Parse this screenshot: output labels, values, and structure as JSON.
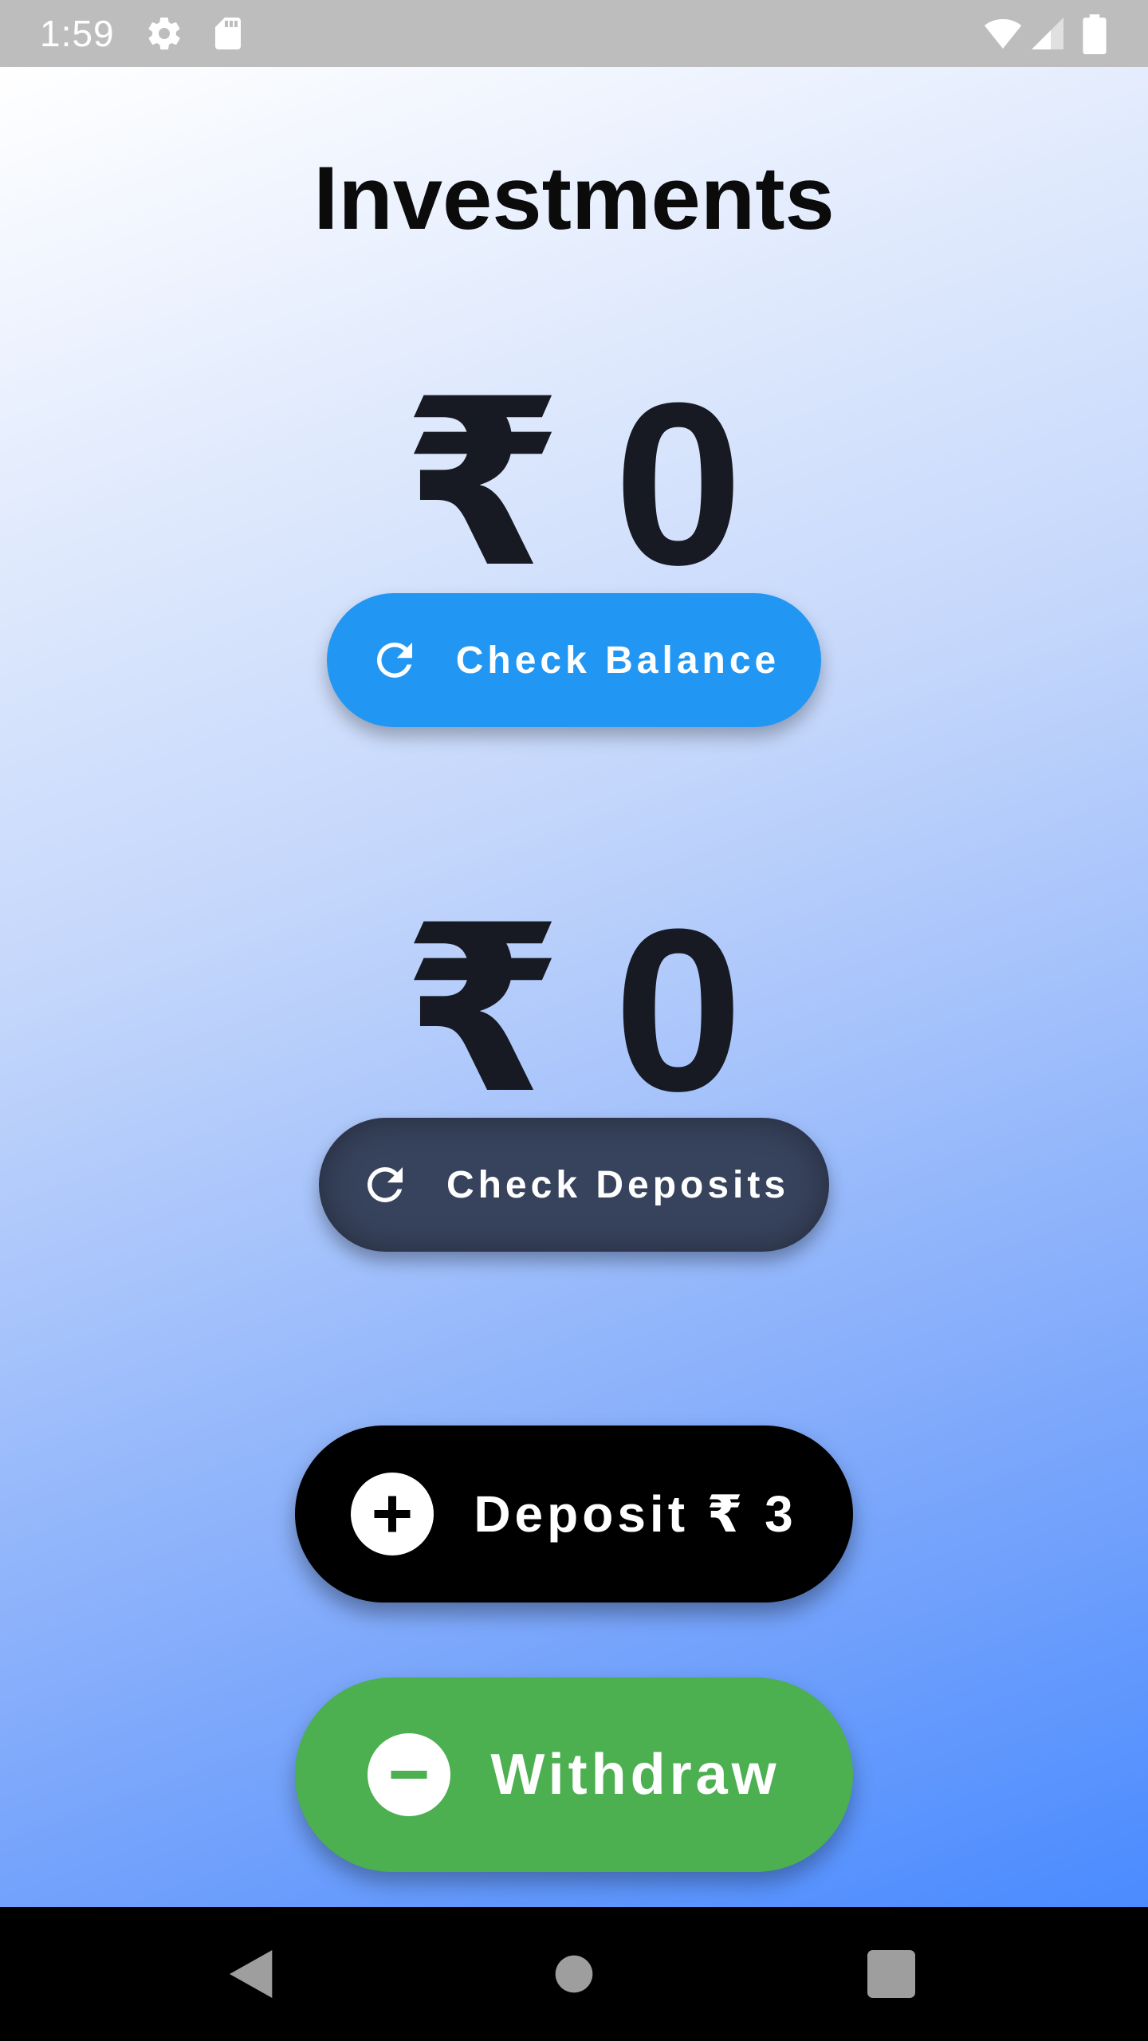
{
  "status_bar": {
    "time": "1:59",
    "icons": [
      "gear-icon",
      "sd-card-icon",
      "wifi-icon",
      "cellular-signal-icon",
      "battery-icon"
    ]
  },
  "page": {
    "title": "Investments"
  },
  "balance": {
    "currency_symbol": "₹",
    "amount": "0",
    "button_label": "Check Balance",
    "button_color": "#2196f3"
  },
  "deposits": {
    "currency_symbol": "₹",
    "amount": "0",
    "button_label": "Check Deposits",
    "button_color": "#37425c"
  },
  "actions": {
    "deposit_label": "Deposit ₹ 3",
    "deposit_color": "#000000",
    "withdraw_label": "Withdraw",
    "withdraw_color": "#4caf50"
  },
  "nav_bar": {
    "icons": [
      "back-icon",
      "home-icon",
      "recents-icon"
    ]
  }
}
